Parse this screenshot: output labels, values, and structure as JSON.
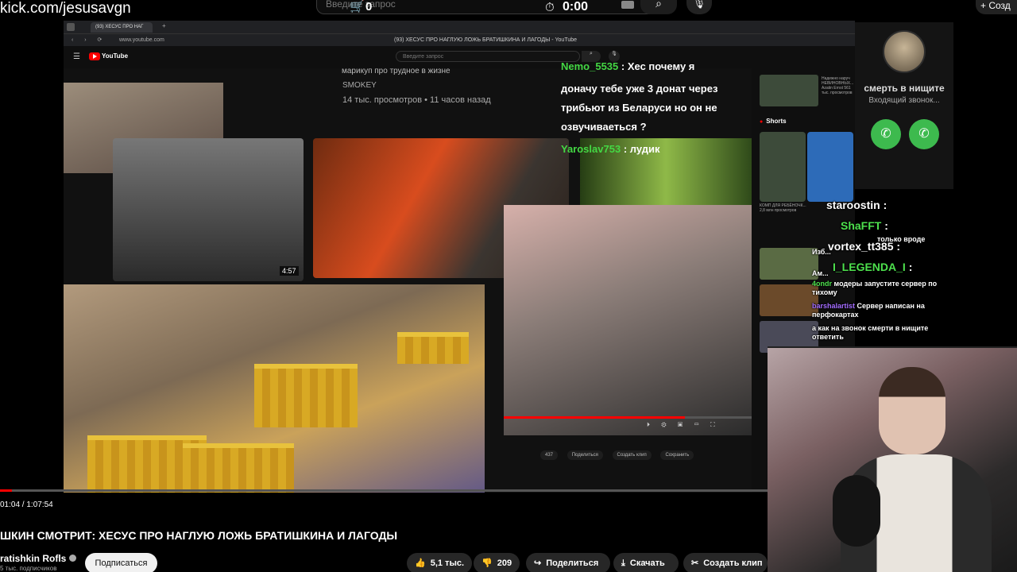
{
  "overlay": {
    "url": "kick.com/jesusavgn",
    "search_placeholder": "Введите запрос",
    "cart_icon": "cart-icon",
    "cart_count": "0",
    "timer": "0:00",
    "create_label": "Созд"
  },
  "browser": {
    "tab_title": "(93) ХЕСУС ПРО НАГ",
    "url": "www.youtube.com",
    "window_title": "(93) ХЕСУС ПРО НАГЛУЮ ЛОЖЬ БРАТИШКИНА И ЛАГОДЫ - YouTube",
    "yt_logo": "YouTube",
    "search_placeholder": "Введите запрос"
  },
  "background_feed": {
    "video_title": "марикуп про трудное в жизне",
    "channel": "SMOKEY",
    "views": "14 тыс. просмотров • 11 часов назад",
    "duration": "4:57"
  },
  "video_chat": [
    {
      "name": "Nemo_5535",
      "text": ": Хес почему я"
    },
    {
      "name": "",
      "text": "доначу тебе уже 3 донат через"
    },
    {
      "name": "",
      "text": "трибьют из Беларуси но он не"
    },
    {
      "name": "",
      "text": "озвучиваеться ?"
    },
    {
      "name": "Yaroslav753",
      "text": ": лудик"
    }
  ],
  "cam_controls": "⏵ ⚙ ▣ ▭ ⛶",
  "yt_actions": [
    "437",
    "Поделиться",
    "Создать клип",
    "Сохранить"
  ],
  "sidebar": {
    "shorts_label": "Shorts",
    "item1_meta": "Надежно наруч НЕВИНОВНЫХ... Azatin Ernst 561 тыс. просмотров",
    "short1_meta": "КОМП ДЛЯ РЕБЁНОЧК... 2,8 млн просмотров",
    "thumb_time": "42:28"
  },
  "call": {
    "name": "смерть в нищите",
    "status": "Входящий звонок..."
  },
  "overlay_chat": [
    {
      "name": "staroostin",
      "text": ":"
    },
    {
      "name": "ShaFFT",
      "text": ":"
    },
    {
      "name": "vortex_tt385",
      "text": ":"
    },
    {
      "name": "I_LEGENDA_I",
      "text": ":"
    },
    {
      "name": "4ondr",
      "text": "модеры запустите сервер по тихому"
    },
    {
      "name": "barshalartist",
      "text": "Сервер написан на перфокартах"
    },
    {
      "name": "",
      "text": "а как на звонок смерти в нищите ответить"
    }
  ],
  "overlay_chat_small": [
    "только вроде",
    "Изб...",
    "Ам..."
  ],
  "player": {
    "time": "01:04 / 1:07:54",
    "progress": 0.016,
    "title": "ШКИН СМОТРИТ: ХЕСУС ПРО НАГЛУЮ ЛОЖЬ БРАТИШКИНА И ЛАГОДЫ",
    "channel": "ratishkin Rofls",
    "subs": "5 тыс. подписчиков",
    "subscribe": "Подписаться",
    "likes": "5,1 тыс.",
    "dislikes": "209",
    "share": "Поделиться",
    "download": "Скачать",
    "clip": "Создать клип"
  },
  "colors": {
    "accent": "#ff0000",
    "chat_name": "#44d844",
    "call_accept": "#3dba4e"
  }
}
